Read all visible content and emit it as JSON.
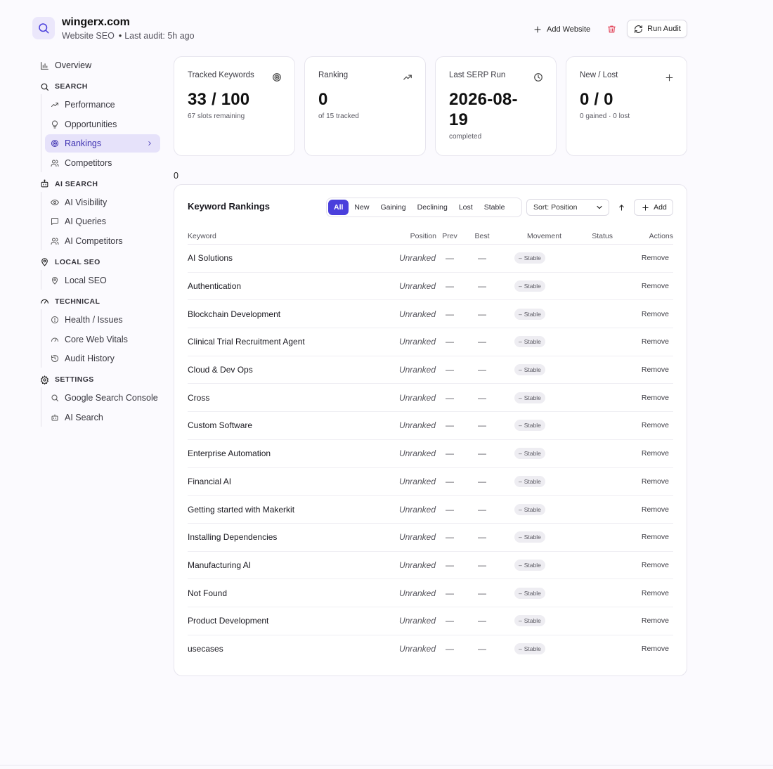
{
  "site": {
    "domain": "wingerx.com",
    "subtitle": "Website SEO",
    "last_audit": "Last audit: 5h ago"
  },
  "header": {
    "add_website": "Add Website",
    "run_audit": "Run Audit"
  },
  "nav": {
    "overview": "Overview",
    "sections": {
      "search": "SEARCH",
      "ai_search": "AI SEARCH",
      "local_seo": "LOCAL SEO",
      "technical": "TECHNICAL",
      "settings": "SETTINGS"
    },
    "items": {
      "performance": "Performance",
      "opportunities": "Opportunities",
      "rankings": "Rankings",
      "competitors": "Competitors",
      "ai_visibility": "AI Visibility",
      "ai_queries": "AI Queries",
      "ai_competitors": "AI Competitors",
      "local_seo": "Local SEO",
      "health": "Health / Issues",
      "cwv": "Core Web Vitals",
      "audit_history": "Audit History",
      "gsc": "Google Search Console",
      "ai_search": "AI Search"
    }
  },
  "stats": {
    "tracked": {
      "label": "Tracked Keywords",
      "value": "33 / 100",
      "sub": "67 slots remaining"
    },
    "ranking": {
      "label": "Ranking",
      "value": "0",
      "sub": "of 15 tracked"
    },
    "serp": {
      "label": "Last SERP Run",
      "value_line1": "2026-08-",
      "value_line2": "19",
      "sub": "completed"
    },
    "newlost": {
      "label": "New / Lost",
      "value": "0 / 0",
      "sub": "0 gained · 0 lost"
    }
  },
  "stray_value": "0",
  "rankings": {
    "title": "Keyword Rankings",
    "filters": [
      "All",
      "New",
      "Gaining",
      "Declining",
      "Lost",
      "Stable"
    ],
    "active_filter": "All",
    "sort_label": "Sort: Position",
    "add_label": "Add",
    "columns": {
      "keyword": "Keyword",
      "position": "Position",
      "prev": "Prev",
      "best": "Best",
      "movement": "Movement",
      "status": "Status",
      "actions": "Actions"
    },
    "rows": [
      {
        "keyword": "AI Solutions",
        "position": "Unranked",
        "prev": "—",
        "best": "—",
        "movement": "Stable",
        "action": "Remove"
      },
      {
        "keyword": "Authentication",
        "position": "Unranked",
        "prev": "—",
        "best": "—",
        "movement": "Stable",
        "action": "Remove"
      },
      {
        "keyword": "Blockchain Development",
        "position": "Unranked",
        "prev": "—",
        "best": "—",
        "movement": "Stable",
        "action": "Remove"
      },
      {
        "keyword": "Clinical Trial Recruitment Agent",
        "position": "Unranked",
        "prev": "—",
        "best": "—",
        "movement": "Stable",
        "action": "Remove"
      },
      {
        "keyword": "Cloud & Dev Ops",
        "position": "Unranked",
        "prev": "—",
        "best": "—",
        "movement": "Stable",
        "action": "Remove"
      },
      {
        "keyword": "Cross",
        "position": "Unranked",
        "prev": "—",
        "best": "—",
        "movement": "Stable",
        "action": "Remove"
      },
      {
        "keyword": "Custom Software",
        "position": "Unranked",
        "prev": "—",
        "best": "—",
        "movement": "Stable",
        "action": "Remove"
      },
      {
        "keyword": "Enterprise Automation",
        "position": "Unranked",
        "prev": "—",
        "best": "—",
        "movement": "Stable",
        "action": "Remove"
      },
      {
        "keyword": "Financial AI",
        "position": "Unranked",
        "prev": "—",
        "best": "—",
        "movement": "Stable",
        "action": "Remove"
      },
      {
        "keyword": "Getting started with Makerkit",
        "position": "Unranked",
        "prev": "—",
        "best": "—",
        "movement": "Stable",
        "action": "Remove"
      },
      {
        "keyword": "Installing Dependencies",
        "position": "Unranked",
        "prev": "—",
        "best": "—",
        "movement": "Stable",
        "action": "Remove"
      },
      {
        "keyword": "Manufacturing AI",
        "position": "Unranked",
        "prev": "—",
        "best": "—",
        "movement": "Stable",
        "action": "Remove"
      },
      {
        "keyword": "Not Found",
        "position": "Unranked",
        "prev": "—",
        "best": "—",
        "movement": "Stable",
        "action": "Remove"
      },
      {
        "keyword": "Product Development",
        "position": "Unranked",
        "prev": "—",
        "best": "—",
        "movement": "Stable",
        "action": "Remove"
      },
      {
        "keyword": "usecases",
        "position": "Unranked",
        "prev": "—",
        "best": "—",
        "movement": "Stable",
        "action": "Remove"
      }
    ]
  },
  "colors": {
    "accent": "#4a3fdc",
    "active_nav_bg": "#e6e2fa",
    "danger": "#e0354b",
    "page_bg": "#fbfafe"
  }
}
